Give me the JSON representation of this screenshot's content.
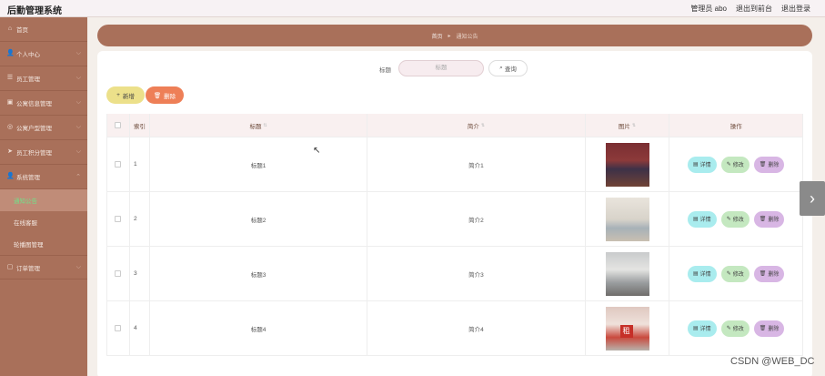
{
  "header": {
    "title": "后勤管理系统",
    "user": "管理员 abo",
    "to_frontend": "退出到前台",
    "logout": "退出登录"
  },
  "sidebar": {
    "items": [
      {
        "label": "首页",
        "icon": "home-icon",
        "glyph": "⌂"
      },
      {
        "label": "个人中心",
        "icon": "user-icon",
        "glyph": "👤"
      },
      {
        "label": "员工管理",
        "icon": "staff-icon",
        "glyph": "☰"
      },
      {
        "label": "公寓信息管理",
        "icon": "building-icon",
        "glyph": "▣"
      },
      {
        "label": "公寓户型管理",
        "icon": "layout-icon",
        "glyph": "◎"
      },
      {
        "label": "员工积分管理",
        "icon": "send-icon",
        "glyph": "➤"
      },
      {
        "label": "系统管理",
        "icon": "system-icon",
        "glyph": "👤"
      },
      {
        "label": "订单管理",
        "icon": "order-icon",
        "glyph": "▢"
      }
    ],
    "sub_items": [
      {
        "label": "通知公告",
        "active": true
      },
      {
        "label": "在线客服",
        "active": false
      },
      {
        "label": "轮播图管理",
        "active": false
      }
    ]
  },
  "breadcrumb": {
    "home": "首页",
    "separator": "▸",
    "current": "通知公告"
  },
  "search": {
    "label": "标题",
    "placeholder": "标题",
    "button": "查询"
  },
  "actions": {
    "add": "新增",
    "delete": "删除"
  },
  "table": {
    "headers": {
      "index": "索引",
      "title": "标题",
      "intro": "简介",
      "image": "图片",
      "ops": "操作"
    },
    "rows": [
      {
        "index": "1",
        "title": "标题1",
        "intro": "简介1"
      },
      {
        "index": "2",
        "title": "标题2",
        "intro": "简介2"
      },
      {
        "index": "3",
        "title": "标题3",
        "intro": "简介3"
      },
      {
        "index": "4",
        "title": "标题4",
        "intro": "简介4"
      }
    ],
    "row_actions": {
      "detail": "详情",
      "edit": "修改",
      "delete": "删除"
    },
    "badge_text": "租"
  },
  "watermark": "CSDN @WEB_DC",
  "colors": {
    "sidebar": "#a9705a",
    "active_text": "#72e08a",
    "add": "#ece08a",
    "delete": "#ee7f57"
  }
}
